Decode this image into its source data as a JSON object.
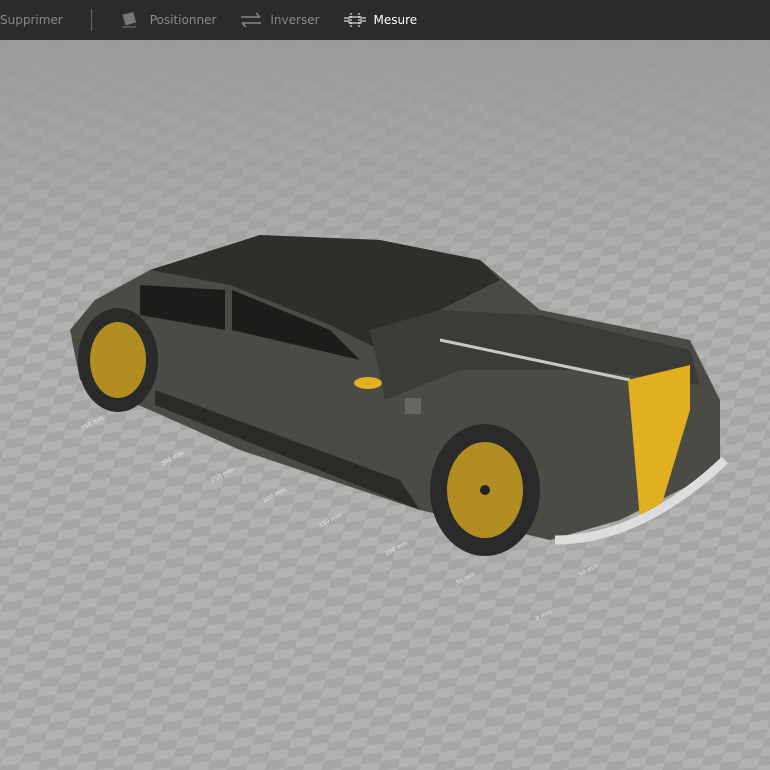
{
  "toolbar": {
    "items": [
      {
        "label": "Supprimer",
        "icon": "delete-icon",
        "active": false
      },
      {
        "label": "Positionner",
        "icon": "position-icon",
        "active": false
      },
      {
        "label": "Inverser",
        "icon": "swap-arrows-icon",
        "active": false
      },
      {
        "label": "Mesure",
        "icon": "measure-icon",
        "active": true
      }
    ]
  },
  "rulers": [
    "350 mm",
    "300 mm",
    "250 mm",
    "200 mm",
    "150 mm",
    "100 mm",
    "50 mm",
    "50 mm",
    "0 mm"
  ],
  "colors": {
    "toolbar_bg": "#2b2b2b",
    "car_body": "#4a4b45",
    "wheel_gold": "#d4a820",
    "accent_gold": "#e0b020"
  }
}
